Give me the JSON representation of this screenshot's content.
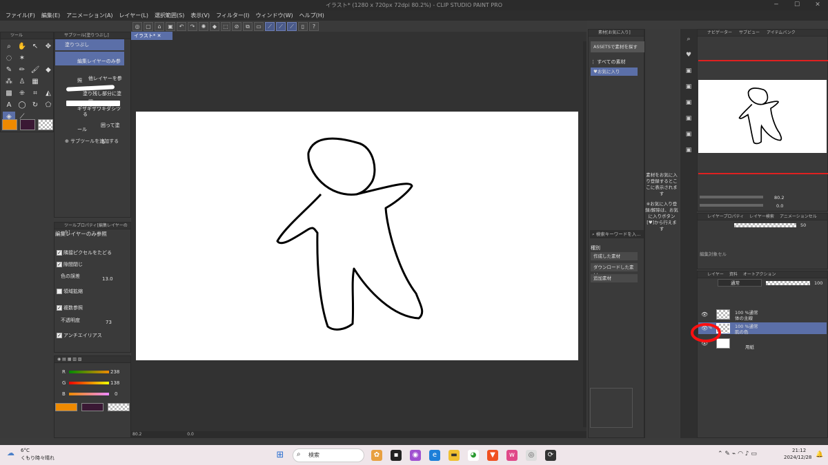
{
  "window": {
    "title": "イラスト* (1280 x 720px 72dpi 80.2%) - CLIP STUDIO PAINT PRO"
  },
  "menu": [
    "ファイル(F)",
    "編集(E)",
    "アニメーション(A)",
    "レイヤー(L)",
    "選択範囲(S)",
    "表示(V)",
    "フィルター(I)",
    "ウィンドウ(W)",
    "ヘルプ(H)"
  ],
  "tool_panel": {
    "tab": "ツール"
  },
  "subtool_panel": {
    "tab": "サブツール[塗りつぶし]",
    "items": [
      "塗りつぶし",
      "編集レイヤーのみ参照",
      "他レイヤーを参照",
      "塗り残し部分に塗る",
      "ギザギザワキダシツール",
      "囲って塗る"
    ],
    "add_label": "サブツールを追加する"
  },
  "tool_property": {
    "tab": "ツールプロパティ[編集レイヤーのみ]",
    "title": "編集レイヤーのみ参照",
    "adjacent": "隣接ピクセルをたどる",
    "close_gap": "隙間閉じ",
    "color_margin_label": "色の誤差",
    "color_margin_value": "13.0",
    "expand": "領域拡縮",
    "multi_ref": "複数参照",
    "opacity_label": "不透明度",
    "opacity_value": "73",
    "antialias": "アンチエイリアス"
  },
  "color_panel": {
    "r": 238,
    "g": 138,
    "b": 0,
    "labels": [
      "R",
      "G",
      "B"
    ],
    "accent": "#ee8a00"
  },
  "canvas_tab": "イラスト*",
  "canvas_status": {
    "zoom": "80.2",
    "angle": "0.0"
  },
  "material_panel": {
    "tab": "素材[お気に入り]",
    "assets_btn": "ASSETSで素材を探す",
    "all": "すべての素材",
    "favorite": "お気に入り",
    "hint": "素材をお気に入り登録するとここに表示されます",
    "hint2": "※お気に入り登録/解除は、お気に入りボタン[♥]から行えます",
    "search_placeholder": "検索キーワードを入…",
    "category_label": "種別",
    "categories": [
      "作成した素材",
      "ダウンロードした素材",
      "追加素材"
    ]
  },
  "navigator": {
    "tabs": [
      "ナビゲーター",
      "サブビュー",
      "アイテムバンク"
    ],
    "zoom": "80.2",
    "angle": "0.0"
  },
  "layer_property": {
    "tabs": [
      "レイヤープロパティ",
      "レイヤー検索",
      "アニメーションセル"
    ],
    "value": "50",
    "cel_label": "編集対象セル"
  },
  "layer_panel": {
    "tabs": [
      "レイヤー",
      "資料",
      "オートアクション"
    ],
    "blend": "通常",
    "opacity": "100",
    "layers": [
      {
        "mode": "100 %通常",
        "name": "体の主線"
      },
      {
        "mode": "100 %通常",
        "name": "肌の色"
      },
      {
        "mode": "",
        "name": "用紙"
      }
    ]
  },
  "taskbar": {
    "weather_temp": "6°C",
    "weather_text": "くもり時々晴れ",
    "search": "検索",
    "time": "21:12",
    "date": "2024/12/28"
  }
}
